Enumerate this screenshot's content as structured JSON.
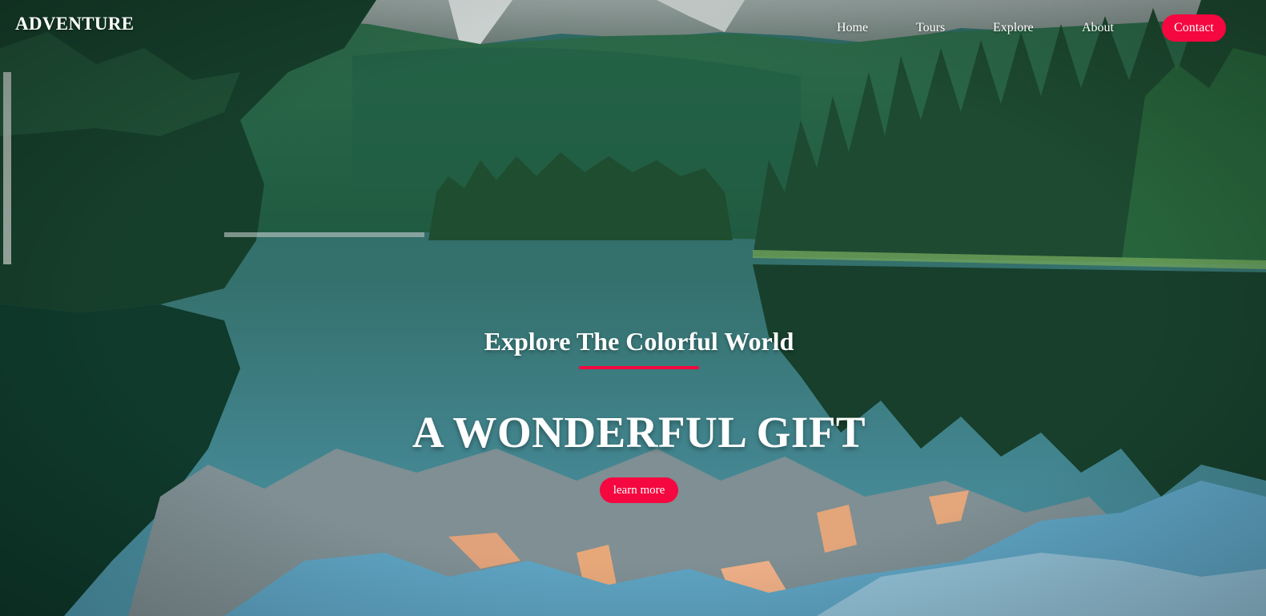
{
  "nav": {
    "brand": "ADVENTURE",
    "links": [
      "Home",
      "Tours",
      "Explore",
      "About"
    ],
    "contact_label": "Contact"
  },
  "hero": {
    "tagline": "Explore The Colorful World",
    "headline": "A WONDERFUL GIFT",
    "cta_label": "learn more",
    "background": "mountain-lake-forest-photo"
  },
  "colors": {
    "accent": "#f5073f",
    "text": "#ffffff"
  }
}
